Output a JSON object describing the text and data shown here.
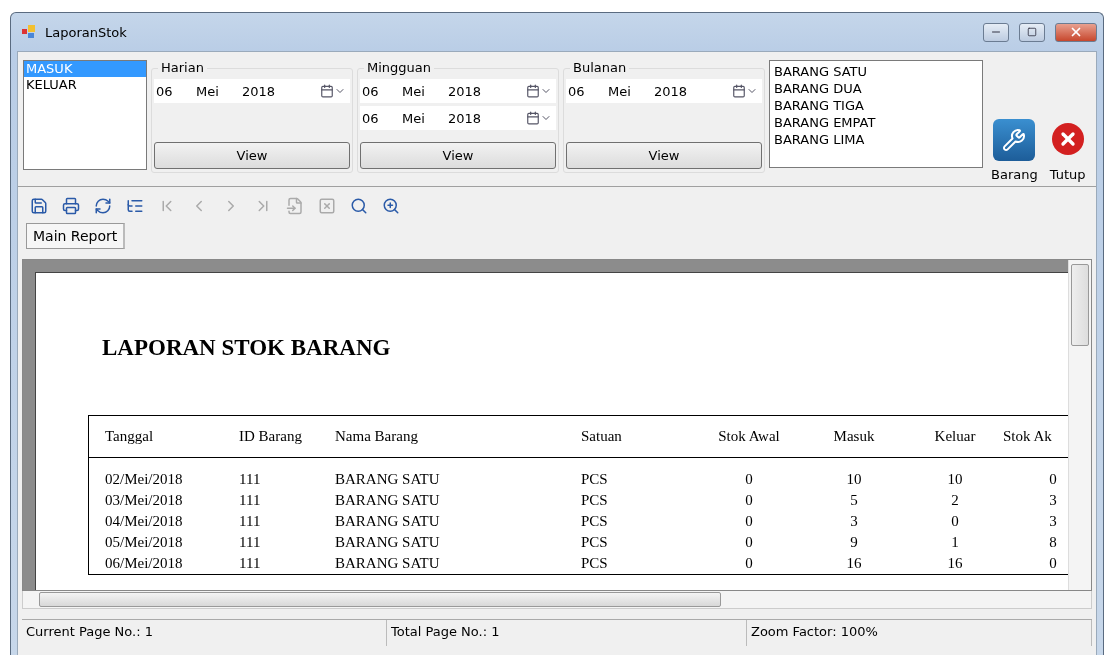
{
  "window": {
    "title": "LaporanStok"
  },
  "type_list": [
    {
      "label": "MASUK",
      "selected": true
    },
    {
      "label": "KELUAR",
      "selected": false
    }
  ],
  "groups": [
    {
      "title": "Harian",
      "dates": [
        {
          "day": "06",
          "month": "Mei",
          "year": "2018"
        }
      ],
      "button": "View"
    },
    {
      "title": "Mingguan",
      "dates": [
        {
          "day": "06",
          "month": "Mei",
          "year": "2018"
        },
        {
          "day": "06",
          "month": "Mei",
          "year": "2018"
        }
      ],
      "button": "View"
    },
    {
      "title": "Bulanan",
      "dates": [
        {
          "day": "06",
          "month": "Mei",
          "year": "2018"
        }
      ],
      "button": "View"
    }
  ],
  "item_list": [
    "BARANG SATU",
    "BARANG DUA",
    "BARANG TIGA",
    "BARANG EMPAT",
    "BARANG LIMA"
  ],
  "actions": [
    {
      "kind": "tools",
      "label": "Barang"
    },
    {
      "kind": "close",
      "label": "Tutup"
    }
  ],
  "toolbar": [
    {
      "kind": "export",
      "disabled": false
    },
    {
      "kind": "print",
      "disabled": false
    },
    {
      "kind": "refresh",
      "disabled": false
    },
    {
      "kind": "tree",
      "disabled": false
    },
    {
      "kind": "first",
      "disabled": true
    },
    {
      "kind": "prev",
      "disabled": true
    },
    {
      "kind": "next",
      "disabled": true
    },
    {
      "kind": "last",
      "disabled": true
    },
    {
      "kind": "goto",
      "disabled": true
    },
    {
      "kind": "stop",
      "disabled": true
    },
    {
      "kind": "find",
      "disabled": false
    },
    {
      "kind": "zoom",
      "disabled": false
    }
  ],
  "tabs": [
    {
      "label": "Main Report",
      "selected": true
    }
  ],
  "report": {
    "title": "LAPORAN STOK BARANG",
    "columns": [
      "Tanggal",
      "ID Barang",
      "Nama Barang",
      "Satuan",
      "Stok Awal",
      "Masuk",
      "Keluar",
      "Stok Ak"
    ],
    "rows": [
      [
        "02/Mei/2018",
        "111",
        "BARANG SATU",
        "PCS",
        "0",
        "10",
        "10",
        "0"
      ],
      [
        "03/Mei/2018",
        "111",
        "BARANG SATU",
        "PCS",
        "0",
        "5",
        "2",
        "3"
      ],
      [
        "04/Mei/2018",
        "111",
        "BARANG SATU",
        "PCS",
        "0",
        "3",
        "0",
        "3"
      ],
      [
        "05/Mei/2018",
        "111",
        "BARANG SATU",
        "PCS",
        "0",
        "9",
        "1",
        "8"
      ],
      [
        "06/Mei/2018",
        "111",
        "BARANG SATU",
        "PCS",
        "0",
        "16",
        "16",
        "0"
      ]
    ]
  },
  "status_bar": [
    "Current Page No.: 1",
    "Total Page No.: 1",
    "Zoom Factor: 100%"
  ]
}
